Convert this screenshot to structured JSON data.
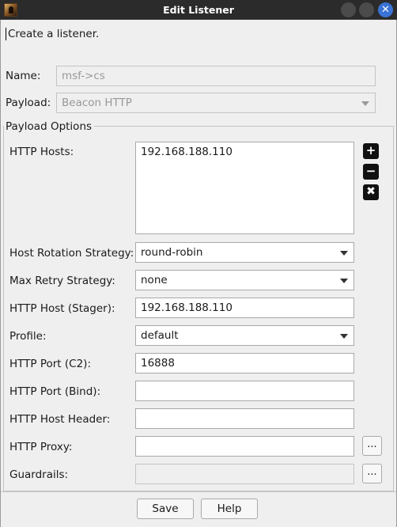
{
  "window": {
    "title": "Edit Listener",
    "close_glyph": "✕"
  },
  "intro": "Create a listener.",
  "name": {
    "label": "Name:",
    "value": "msf->cs"
  },
  "payload": {
    "label": "Payload:",
    "value": "Beacon HTTP"
  },
  "options": {
    "title": "Payload Options",
    "http_hosts": {
      "label": "HTTP Hosts:",
      "items": [
        "192.168.188.110"
      ],
      "add_glyph": "+",
      "remove_glyph": "−",
      "clear_glyph": "✖"
    },
    "rotation": {
      "label": "Host Rotation Strategy:",
      "value": "round-robin"
    },
    "retry": {
      "label": "Max Retry Strategy:",
      "value": "none"
    },
    "stager_host": {
      "label": "HTTP Host (Stager):",
      "value": "192.168.188.110"
    },
    "profile": {
      "label": "Profile:",
      "value": "default"
    },
    "port_c2": {
      "label": "HTTP Port (C2):",
      "value": "16888"
    },
    "port_bind": {
      "label": "HTTP Port (Bind):",
      "value": ""
    },
    "host_header": {
      "label": "HTTP Host Header:",
      "value": ""
    },
    "proxy": {
      "label": "HTTP Proxy:",
      "value": "",
      "button": "..."
    },
    "guardrails": {
      "label": "Guardrails:",
      "value": "",
      "button": "..."
    }
  },
  "buttons": {
    "save": "Save",
    "help": "Help"
  }
}
